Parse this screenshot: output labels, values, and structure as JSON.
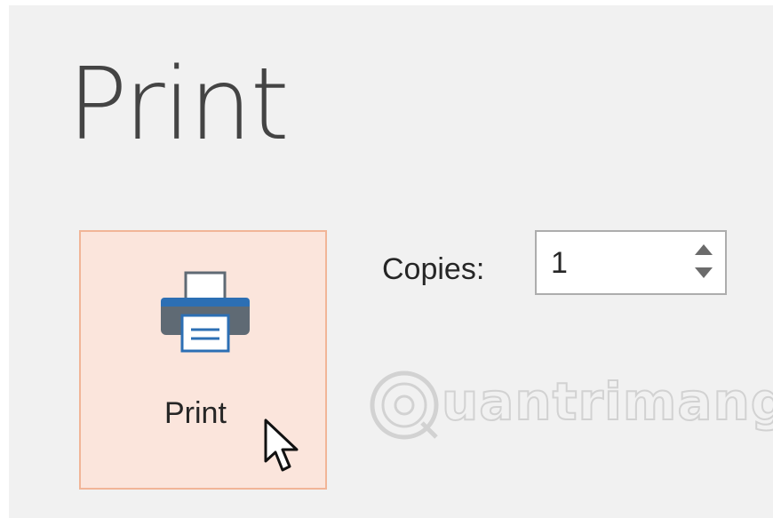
{
  "page": {
    "title": "Print"
  },
  "print_button": {
    "label": "Print",
    "icon": "printer-icon"
  },
  "copies": {
    "label": "Copies:",
    "value": "1",
    "up_icon": "spin-up-icon",
    "down_icon": "spin-down-icon"
  },
  "watermark": {
    "text": "uantrimang"
  },
  "colors": {
    "panel_bg": "#f1f1f1",
    "button_bg": "#fbe5dc",
    "button_border": "#f1b597",
    "printer_gray": "#5f6a74",
    "printer_blue": "#2c6fb4"
  }
}
